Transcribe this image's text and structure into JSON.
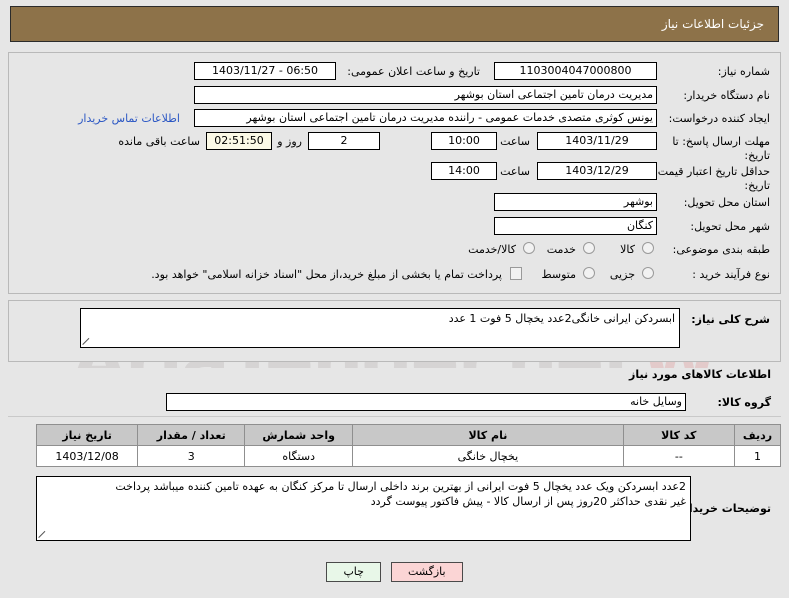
{
  "header": {
    "title": "جزئیات اطلاعات نیاز"
  },
  "watermark": {
    "text": "AriaTender.net",
    "mark": "W"
  },
  "form": {
    "need_number_label": "شماره نیاز:",
    "need_number_value": "1103004047000800",
    "announce_label": "تاریخ و ساعت اعلان عمومی:",
    "announce_value": "06:50 - 1403/11/27",
    "buyer_org_label": "نام دستگاه خریدار:",
    "buyer_org_value": "مدیریت درمان تامین اجتماعی استان بوشهر",
    "creator_label": "ایجاد کننده درخواست:",
    "creator_value": "یونس کوثری متصدی خدمات عمومی - راننده مدیریت درمان تامین اجتماعی استان بوشهر",
    "contact_link": "اطلاعات تماس خریدار",
    "deadline_label_line1": "مهلت ارسال پاسخ: تا",
    "deadline_label_line2": "تاریخ:",
    "deadline_date": "1403/11/29",
    "deadline_hour_label": "ساعت",
    "deadline_hour": "10:00",
    "remaining_days": "2",
    "remaining_days_label": "روز و",
    "remaining_time": "02:51:50",
    "remaining_suffix": "ساعت باقی مانده",
    "validity_label_line1": "حداقل تاریخ اعتبار قیمت: تا",
    "validity_label_line2": "تاریخ:",
    "validity_date": "1403/12/29",
    "validity_hour_label": "ساعت",
    "validity_hour": "14:00",
    "province_label": "استان محل تحویل:",
    "province_value": "بوشهر",
    "city_label": "شهر محل تحویل:",
    "city_value": "کنگان",
    "category_label": "طبقه بندی موضوعی:",
    "category_options": [
      "کالا",
      "خدمت",
      "کالا/خدمت"
    ],
    "process_label": "نوع فرآیند خرید :",
    "process_options": [
      "جزیی",
      "متوسط"
    ],
    "treasury_note": "پرداخت تمام یا بخشی از مبلغ خرید،از محل \"اسناد خزانه اسلامی\" خواهد بود."
  },
  "description": {
    "label": "شرح کلی نیاز:",
    "value": "ابسردکن ایرانی خانگی2عدد یخچال 5 فوت 1 عدد"
  },
  "goods": {
    "section_title": "اطلاعات کالاهای مورد نیاز",
    "group_label": "گروه کالا:",
    "group_value": "وسایل خانه",
    "columns": [
      "ردیف",
      "کد کالا",
      "نام کالا",
      "واحد شمارش",
      "تعداد / مقدار",
      "تاریخ نیاز"
    ],
    "rows": [
      {
        "row": "1",
        "code": "--",
        "name": "یخچال خانگی",
        "unit": "دستگاه",
        "quantity": "3",
        "date": "1403/12/08"
      }
    ]
  },
  "notes": {
    "label": "توضیحات خریدار:",
    "line1": "2عدد ابسردکن ویک عدد یخچال 5 فوت ایرانی از بهترین برند داخلی ارسال تا مرکز کنگان به عهده تامین کننده میباشد پرداخت",
    "line2": "غیر نقدی حداکثر 20روز پس از ارسال کالا - پیش فاکتور پیوست گردد"
  },
  "footer": {
    "print_label": "چاپ",
    "back_label": "بازگشت"
  },
  "colors": {
    "header_bg": "#8d7249",
    "page_bg": "#e6e6e6",
    "link": "#2b57c4",
    "table_header_bg": "#c8c8c8",
    "print_btn_bg": "#e8f7e8",
    "back_btn_bg": "#fbd5d5",
    "timer_bg": "#fbf9e6"
  }
}
